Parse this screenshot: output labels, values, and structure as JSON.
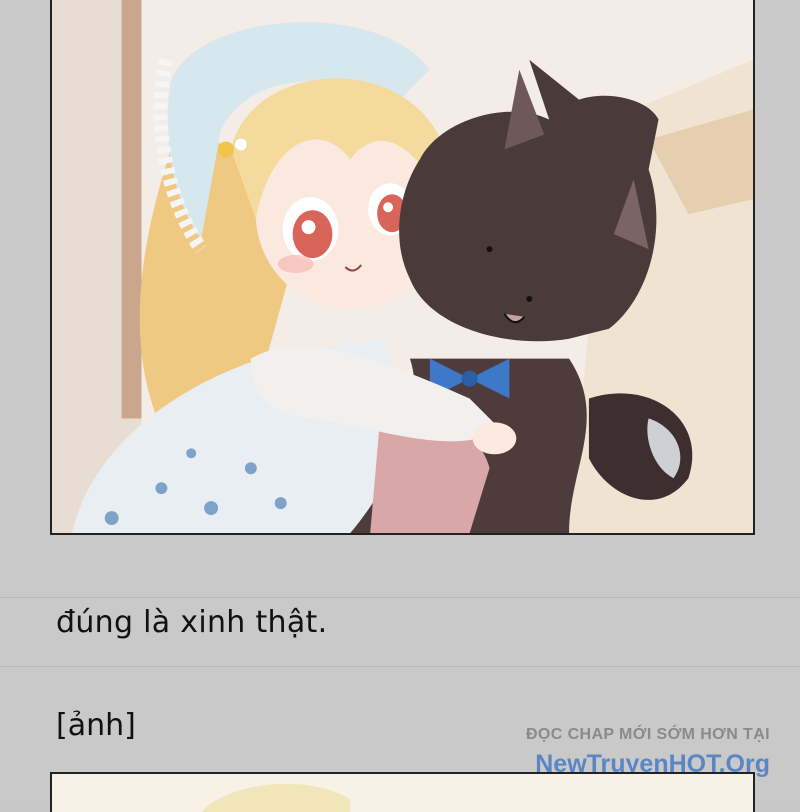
{
  "panel": {
    "alt": "Manga panel: little blonde girl hugging a dark plush cat"
  },
  "caption": {
    "text": "đúng là xinh thật."
  },
  "image_tag": {
    "text": "[ảnh]"
  },
  "watermark": {
    "line1": "ĐỌC CHAP MỚI SỚM HƠN TẠI",
    "line2": "NewTruyenHOT.Org"
  },
  "colors": {
    "background": "#c9c9c9",
    "watermark_blue": "#5b86c3",
    "watermark_gray": "#8a8a8a"
  }
}
